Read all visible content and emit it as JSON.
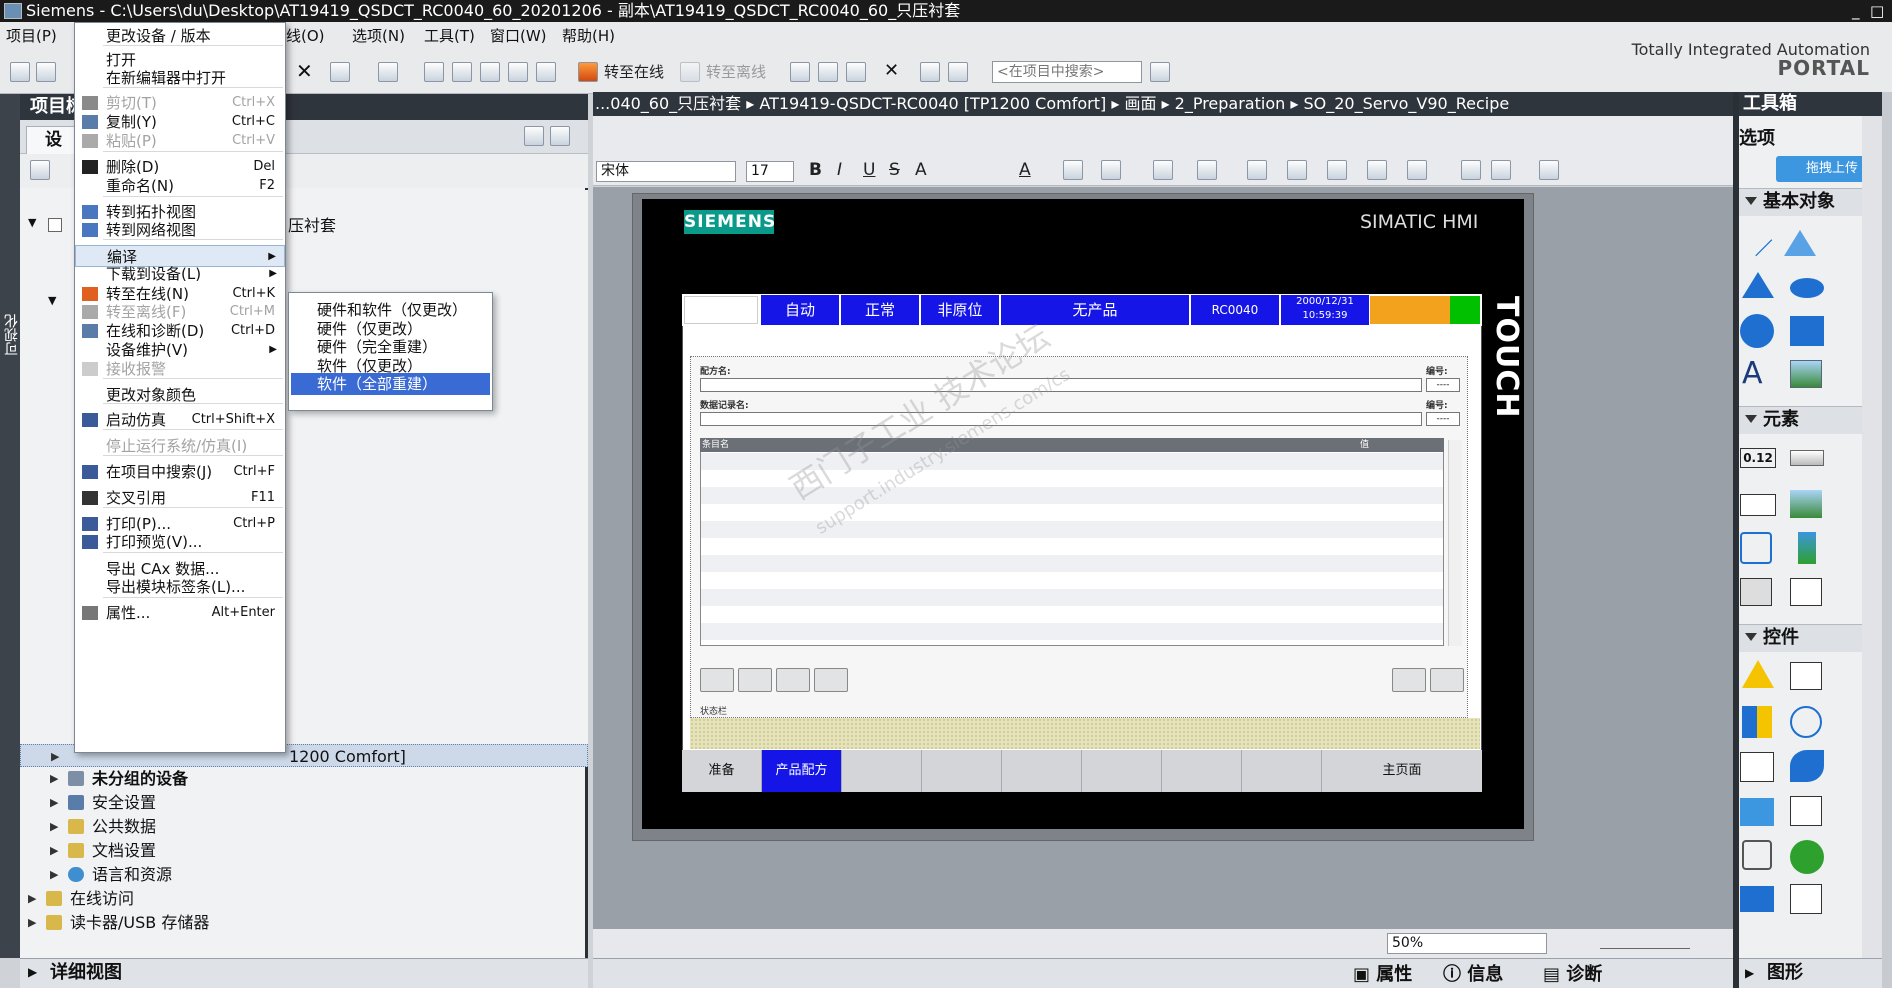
{
  "window": {
    "app": "Siemens",
    "title": "C:\\Users\\du\\Desktop\\AT19419_QSDCT_RC0040_60_20201206 - 副本\\AT19419_QSDCT_RC0040_60_只压衬套",
    "controls": [
      "_",
      "□",
      "×"
    ]
  },
  "menubar": {
    "items": [
      "项目(P)",
      "线(O)",
      "选项(N)",
      "工具(T)",
      "窗口(W)",
      "帮助(H)"
    ]
  },
  "toolbar": {
    "go_online": "转至在线",
    "go_offline": "转至离线",
    "search_placeholder": "<在项目中搜索>"
  },
  "branding": {
    "line1": "Totally Integrated Automation",
    "line2": "PORTAL"
  },
  "left_pane": {
    "header": "项目树",
    "side_tab": "可视化",
    "tab_devices": "设备",
    "bottom": "详细视图"
  },
  "tree": {
    "items": [
      {
        "label": "压衬套"
      },
      {
        "label": "1200 Comfort]"
      },
      {
        "label": "未分组的设备"
      },
      {
        "label": "安全设置"
      },
      {
        "label": "公共数据"
      },
      {
        "label": "文档设置"
      },
      {
        "label": "语言和资源"
      },
      {
        "label": "在线访问"
      },
      {
        "label": "读卡器/USB 存储器"
      }
    ]
  },
  "context_menu": {
    "items": [
      {
        "label": "更改设备 / 版本",
        "shortcut": "",
        "disabled": false
      },
      {
        "label": "打开",
        "shortcut": "",
        "disabled": false
      },
      {
        "label": "在新编辑器中打开",
        "shortcut": "",
        "disabled": false
      },
      {
        "label": "剪切(T)",
        "shortcut": "Ctrl+X",
        "disabled": true
      },
      {
        "label": "复制(Y)",
        "shortcut": "Ctrl+C",
        "disabled": false
      },
      {
        "label": "粘贴(P)",
        "shortcut": "Ctrl+V",
        "disabled": true
      },
      {
        "label": "删除(D)",
        "shortcut": "Del",
        "disabled": false
      },
      {
        "label": "重命名(N)",
        "shortcut": "F2",
        "disabled": false
      },
      {
        "label": "转到拓扑视图",
        "shortcut": "",
        "disabled": false
      },
      {
        "label": "转到网络视图",
        "shortcut": "",
        "disabled": false
      },
      {
        "label": "编译",
        "shortcut": "",
        "disabled": false
      },
      {
        "label": "下载到设备(L)",
        "shortcut": "",
        "disabled": false
      },
      {
        "label": "转至在线(N)",
        "shortcut": "Ctrl+K",
        "disabled": false
      },
      {
        "label": "转至离线(F)",
        "shortcut": "Ctrl+M",
        "disabled": true
      },
      {
        "label": "在线和诊断(D)",
        "shortcut": "Ctrl+D",
        "disabled": false
      },
      {
        "label": "设备维护(V)",
        "shortcut": "",
        "disabled": false
      },
      {
        "label": "接收报警",
        "shortcut": "",
        "disabled": true
      },
      {
        "label": "更改对象颜色",
        "shortcut": "",
        "disabled": false
      },
      {
        "label": "启动仿真",
        "shortcut": "Ctrl+Shift+X",
        "disabled": false
      },
      {
        "label": "停止运行系统/仿真(I)",
        "shortcut": "",
        "disabled": true
      },
      {
        "label": "在项目中搜索(J)",
        "shortcut": "Ctrl+F",
        "disabled": false
      },
      {
        "label": "交叉引用",
        "shortcut": "F11",
        "disabled": false
      },
      {
        "label": "打印(P)...",
        "shortcut": "Ctrl+P",
        "disabled": false
      },
      {
        "label": "打印预览(V)...",
        "shortcut": "",
        "disabled": false
      },
      {
        "label": "导出 CAx 数据...",
        "shortcut": "",
        "disabled": false
      },
      {
        "label": "导出模块标签条(L)...",
        "shortcut": "",
        "disabled": false
      },
      {
        "label": "属性...",
        "shortcut": "Alt+Enter",
        "disabled": false
      }
    ],
    "submenu": [
      "硬件和软件（仅更改）",
      "硬件（仅更改）",
      "硬件（完全重建）",
      "软件（仅更改）",
      "软件（全部重建）"
    ]
  },
  "editor": {
    "breadcrumb": "...040_60_只压衬套 ▸ AT19419-QSDCT-RC0040 [TP1200 Comfort] ▸ 画面 ▸ 2_Preparation ▸ SO_20_Servo_V90_Recipe",
    "font": "宋体",
    "font_size": "17",
    "zoom": "50%"
  },
  "hmi": {
    "brand": "SIEMENS",
    "model": "SIMATIC HMI",
    "touch": "TOUCH",
    "header": [
      "自动",
      "正常",
      "非原位",
      "无产品",
      "RC0040"
    ],
    "date": "2000/12/31",
    "time": "10:59:39",
    "recipe_label": "配方名:",
    "record_label": "数据记录名:",
    "number_label": "编号:",
    "number_value": "----",
    "col_entry": "条目名",
    "col_value": "值",
    "status": "状态栏",
    "nav": [
      "准备",
      "产品配方",
      "",
      "",
      "",
      "",
      "",
      "",
      "主页面"
    ]
  },
  "watermark": {
    "line1": "西门子工业 技术论坛",
    "line2": "support.industry.siemens.com/cs"
  },
  "toolbox": {
    "header": "工具箱",
    "options": "选项",
    "sections": [
      "基本对象",
      "元素",
      "控件",
      "图形"
    ],
    "upload": "拖拽上传",
    "value": "0.12"
  },
  "bottom_tabs": {
    "properties": "属性",
    "info": "信息",
    "diag": "诊断"
  },
  "colors": {
    "hmi_blue": "#1515e8",
    "accent": "#3a6bd4",
    "siemens_teal": "#0a9a8a"
  }
}
